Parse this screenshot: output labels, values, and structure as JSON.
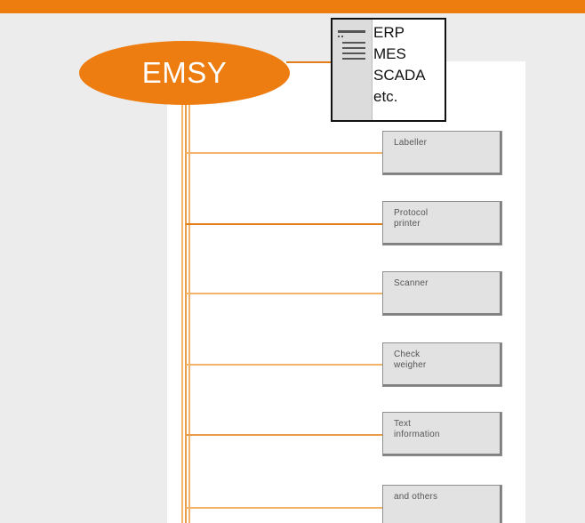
{
  "colors": {
    "accent": "#ED7D0E",
    "line": "#F4B36B",
    "line_dark": "#E27E1A",
    "background": "#ECECEC",
    "panel": "#FFFFFF",
    "device_fill": "#E2E2E2",
    "device_border": "#8F8F8F"
  },
  "diagram": {
    "central_node": {
      "label": "EMSY"
    },
    "external_system": {
      "lines": [
        "ERP",
        "MES",
        "SCADA",
        "etc."
      ],
      "icon": "document-list-icon"
    },
    "devices": [
      {
        "id": "labeller",
        "lines": [
          "Labeller"
        ]
      },
      {
        "id": "protocol-printer",
        "lines": [
          "Protocol",
          "printer"
        ]
      },
      {
        "id": "scanner",
        "lines": [
          "Scanner"
        ]
      },
      {
        "id": "check-weigher",
        "lines": [
          "Check",
          "weigher"
        ]
      },
      {
        "id": "text-information",
        "lines": [
          "Text",
          "information"
        ]
      },
      {
        "id": "and-others",
        "lines": [
          "and others"
        ]
      }
    ]
  }
}
